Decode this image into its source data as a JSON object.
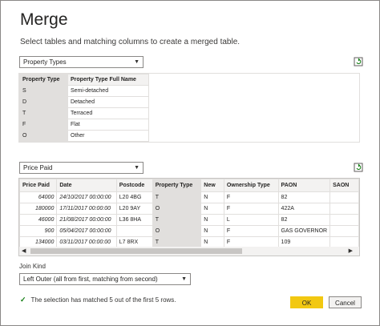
{
  "dialog": {
    "title": "Merge",
    "subtitle": "Select tables and matching columns to create a merged table."
  },
  "table1": {
    "selected": "Property Types",
    "headers": [
      "Property Type",
      "Property Type Full Name"
    ],
    "rows": [
      [
        "S",
        "Semi-detached"
      ],
      [
        "D",
        "Detached"
      ],
      [
        "T",
        "Terraced"
      ],
      [
        "F",
        "Flat"
      ],
      [
        "O",
        "Other"
      ]
    ]
  },
  "table2": {
    "selected": "Price Paid",
    "headers": [
      "Price Paid",
      "Date",
      "Postcode",
      "Property Type",
      "New",
      "Ownership Type",
      "PAON",
      "SAON"
    ],
    "rows": [
      [
        "64000",
        "24/10/2017 00:00:00",
        "L20 4BG",
        "T",
        "N",
        "F",
        "82",
        ""
      ],
      [
        "180000",
        "17/11/2017 00:00:00",
        "L20 9AY",
        "O",
        "N",
        "F",
        "422A",
        ""
      ],
      [
        "46000",
        "21/08/2017 00:00:00",
        "L36 8HA",
        "T",
        "N",
        "L",
        "82",
        ""
      ],
      [
        "900",
        "05/04/2017 00:00:00",
        "",
        "O",
        "N",
        "F",
        "GAS GOVERNOR",
        ""
      ],
      [
        "134000",
        "03/11/2017 00:00:00",
        "L7 8RX",
        "T",
        "N",
        "F",
        "109",
        ""
      ]
    ]
  },
  "join": {
    "label": "Join Kind",
    "selected": "Left Outer (all from first, matching from second)"
  },
  "status": "The selection has matched 5 out of the first 5 rows.",
  "buttons": {
    "ok": "OK",
    "cancel": "Cancel"
  },
  "icons": {
    "refresh": "refresh-icon",
    "chevron": "chevron-down-icon",
    "check": "checkmark-icon"
  },
  "colors": {
    "accent": "#f2c811",
    "success": "#107c10",
    "selection": "#e1dfdd"
  }
}
